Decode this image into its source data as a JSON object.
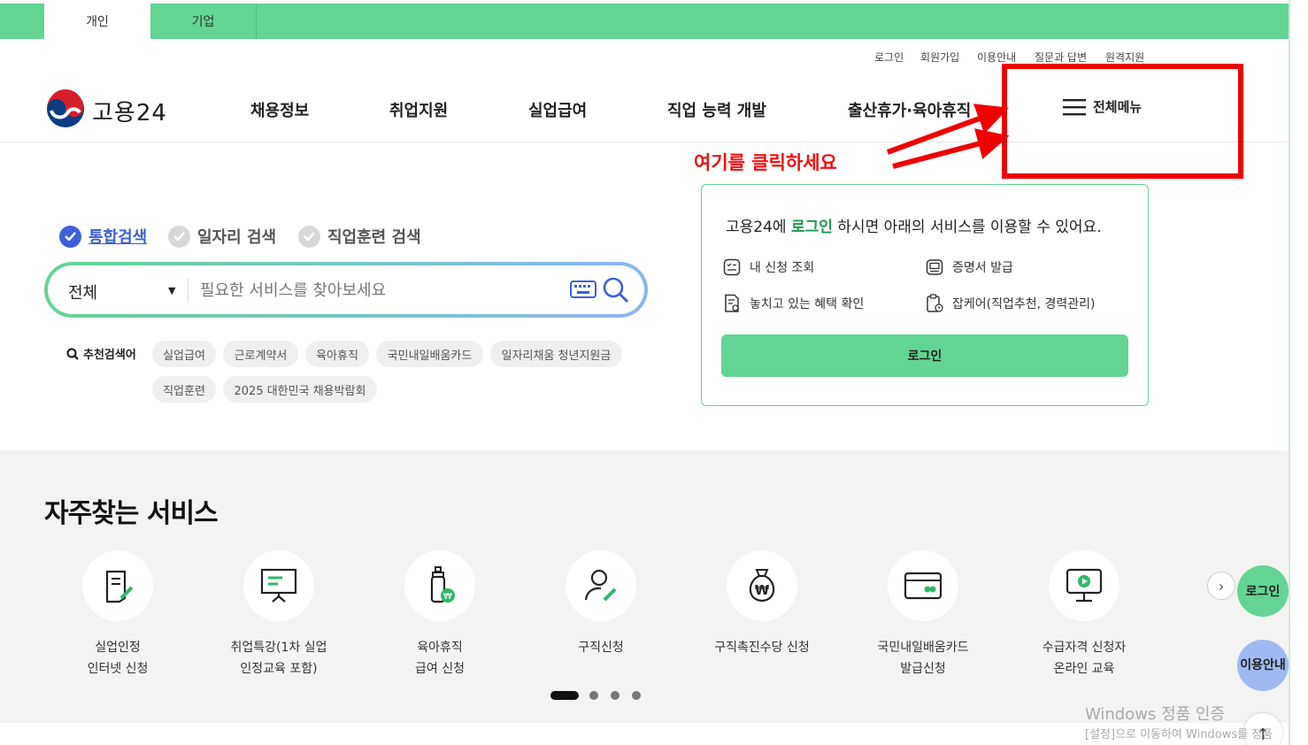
{
  "colors": {
    "brand_green": "#63d493",
    "accent_blue": "#3d5fd8",
    "annotation_red": "#ee0000"
  },
  "top_tabs": [
    "개인",
    "기업"
  ],
  "utility_links": [
    "로그인",
    "회원가입",
    "이용안내",
    "질문과 답변",
    "원격지원"
  ],
  "logo": {
    "text": "고용24",
    "icon": "korea-emblem-icon"
  },
  "nav": [
    "채용정보",
    "취업지원",
    "실업급여",
    "직업 능력 개발",
    "출산휴가·육아휴직"
  ],
  "all_menu": {
    "label": "전체메뉴",
    "icon": "hamburger-icon"
  },
  "annotation": {
    "text": "여기를 클릭하세요"
  },
  "search": {
    "types": [
      {
        "label": "통합검색",
        "active": true
      },
      {
        "label": "일자리 검색",
        "active": false
      },
      {
        "label": "직업훈련 검색",
        "active": false
      }
    ],
    "category": "전체",
    "placeholder": "필요한 서비스를 찾아보세요",
    "recommend_label": "추천검색어",
    "keywords": [
      "실업급여",
      "근로계약서",
      "육아휴직",
      "국민내일배움카드",
      "일자리채움 청년지원금",
      "직업훈련",
      "2025 대한민국 채용박람회"
    ]
  },
  "login_card": {
    "msg_pre": "고용24에 ",
    "msg_link": "로그인",
    "msg_post": " 하시면 아래의 서비스를 이용할 수 있어요.",
    "services": [
      "내 신청 조회",
      "증명서 발급",
      "놓치고 있는 혜택 확인",
      "잡케어(직업추천, 경력관리)"
    ],
    "button": "로그인"
  },
  "frequent": {
    "title": "자주찾는 서비스",
    "items": [
      {
        "line1": "실업인정",
        "line2": "인터넷 신청",
        "icon": "document-pen-icon"
      },
      {
        "line1": "취업특강(1차 실업",
        "line2": "인정교육 포함)",
        "icon": "presentation-board-icon"
      },
      {
        "line1": "육아휴직",
        "line2": "급여 신청",
        "icon": "baby-bottle-won-icon"
      },
      {
        "line1": "구직신청",
        "line2": "",
        "icon": "person-pen-icon"
      },
      {
        "line1": "구직촉진수당 신청",
        "line2": "",
        "icon": "money-bag-won-icon"
      },
      {
        "line1": "국민내일배움카드",
        "line2": "발급신청",
        "icon": "card-icon"
      },
      {
        "line1": "수급자격 신청자",
        "line2": "온라인 교육",
        "icon": "monitor-play-icon"
      }
    ],
    "pager": {
      "current": 1,
      "total": 4
    }
  },
  "floating": {
    "login": "로그인",
    "guide_line1": "이용",
    "guide_line2": "안내",
    "top": "↑"
  },
  "watermark": {
    "line1": "Windows 정품 인증",
    "line2": "[설정]으로 이동하여 Windows를 정품"
  }
}
